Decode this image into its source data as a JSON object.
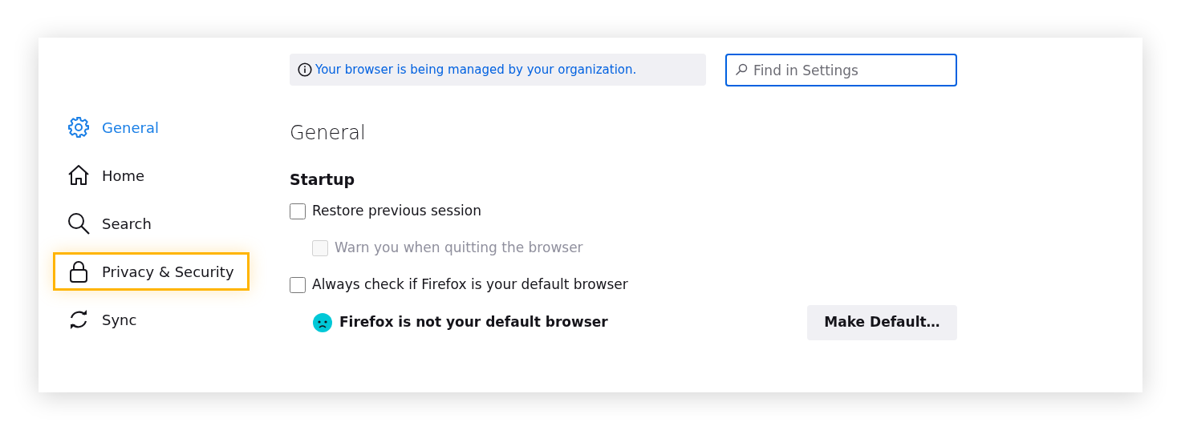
{
  "sidebar": {
    "items": [
      {
        "kind": "gear",
        "label": "General",
        "selected": true,
        "highlighted": false
      },
      {
        "kind": "home",
        "label": "Home",
        "selected": false,
        "highlighted": false
      },
      {
        "kind": "search",
        "label": "Search",
        "selected": false,
        "highlighted": false
      },
      {
        "kind": "lock",
        "label": "Privacy & Security",
        "selected": false,
        "highlighted": true
      },
      {
        "kind": "sync",
        "label": "Sync",
        "selected": false,
        "highlighted": false
      }
    ]
  },
  "notice": {
    "text": "Your browser is being managed by your organization."
  },
  "search": {
    "placeholder": "Find in Settings"
  },
  "heading": "General",
  "section": {
    "title": "Startup",
    "options": [
      {
        "label": "Restore previous session",
        "checked": false,
        "disabled": false,
        "indented": false
      },
      {
        "label": "Warn you when quitting the browser",
        "checked": false,
        "disabled": true,
        "indented": true
      },
      {
        "label": "Always check if Firefox is your default browser",
        "checked": false,
        "disabled": false,
        "indented": false
      }
    ],
    "status": {
      "text": "Firefox is not your default browser",
      "button": "Make Default…"
    }
  }
}
